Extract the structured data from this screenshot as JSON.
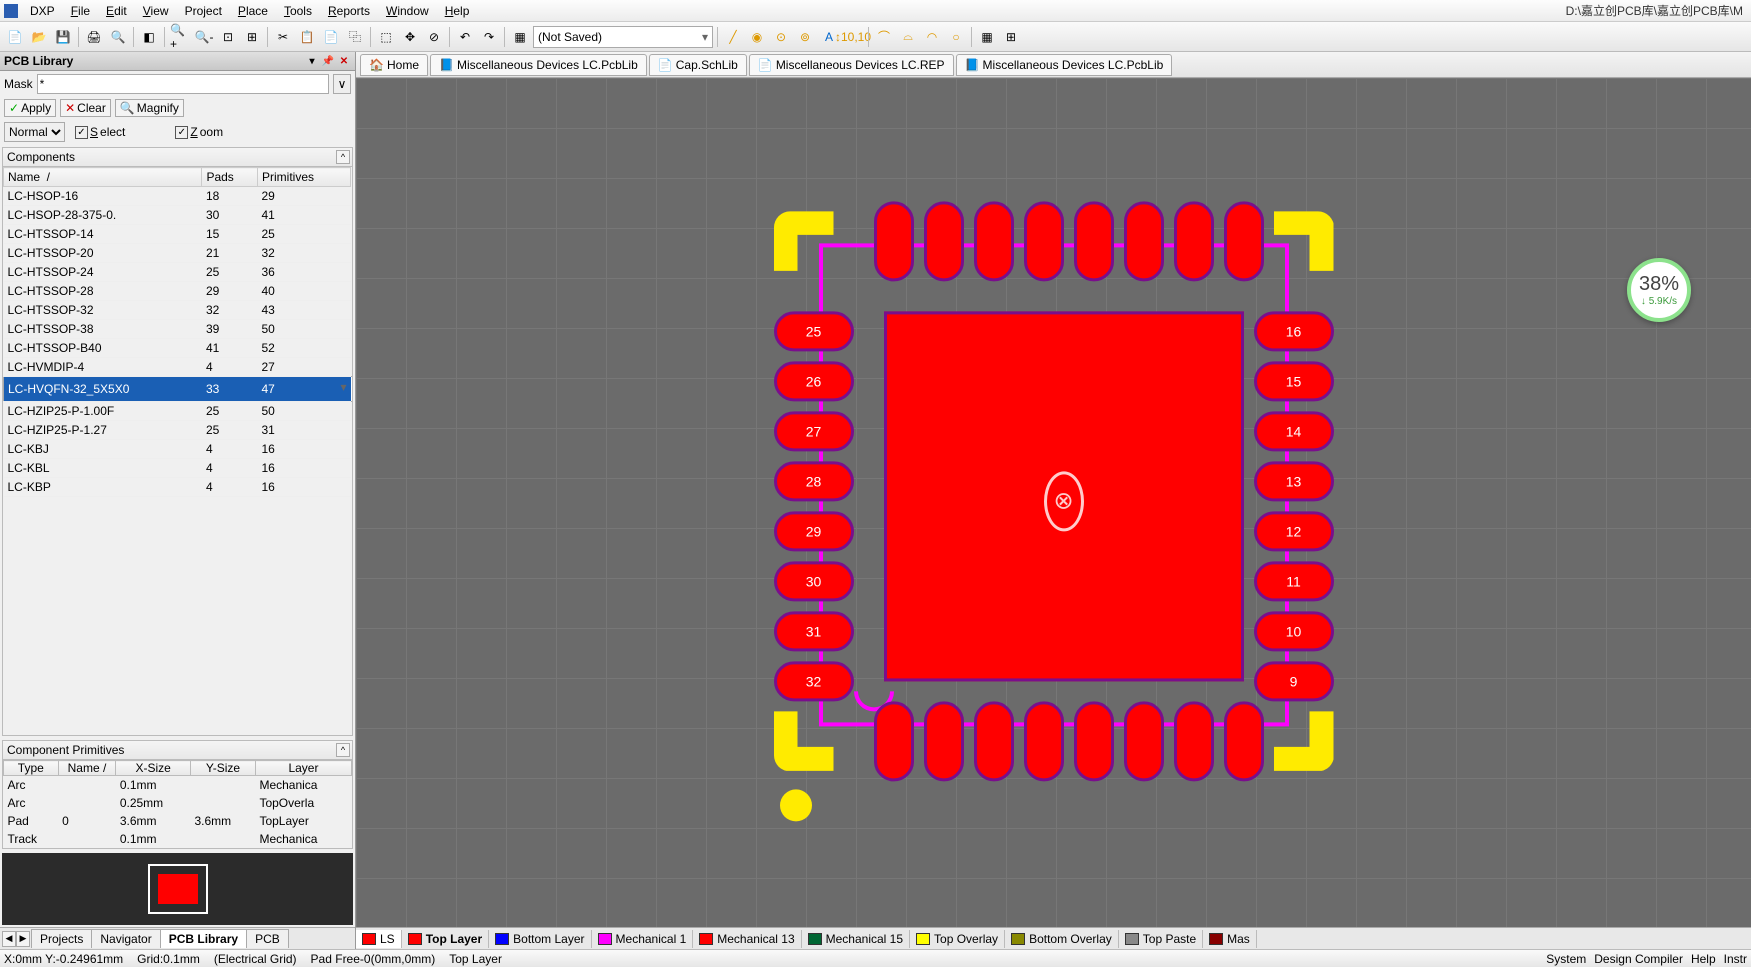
{
  "menu": {
    "dxp": "DXP",
    "file": "File",
    "edit": "Edit",
    "view": "View",
    "project": "Project",
    "place": "Place",
    "tools": "Tools",
    "reports": "Reports",
    "window": "Window",
    "help": "Help"
  },
  "titlepath": "D:\\嘉立创PCB库\\嘉立创PCB库\\M",
  "toolbar": {
    "notsaved": "(Not Saved)"
  },
  "panel": {
    "title": "PCB Library",
    "mask_label": "Mask",
    "mask_value": "*",
    "apply": "Apply",
    "clear": "Clear",
    "magnify": "Magnify",
    "normal": "Normal",
    "select": "Select",
    "zoom": "Zoom",
    "components": "Components",
    "cols": {
      "name": "Name",
      "pads": "Pads",
      "prims": "Primitives"
    },
    "rows": [
      {
        "n": "LC-HSOP-16",
        "p": "18",
        "r": "29"
      },
      {
        "n": "LC-HSOP-28-375-0.",
        "p": "30",
        "r": "41"
      },
      {
        "n": "LC-HTSSOP-14",
        "p": "15",
        "r": "25"
      },
      {
        "n": "LC-HTSSOP-20",
        "p": "21",
        "r": "32"
      },
      {
        "n": "LC-HTSSOP-24",
        "p": "25",
        "r": "36"
      },
      {
        "n": "LC-HTSSOP-28",
        "p": "29",
        "r": "40"
      },
      {
        "n": "LC-HTSSOP-32",
        "p": "32",
        "r": "43"
      },
      {
        "n": "LC-HTSSOP-38",
        "p": "39",
        "r": "50"
      },
      {
        "n": "LC-HTSSOP-B40",
        "p": "41",
        "r": "52"
      },
      {
        "n": "LC-HVMDIP-4",
        "p": "4",
        "r": "27"
      },
      {
        "n": "LC-HVQFN-32_5X5X0",
        "p": "33",
        "r": "47",
        "sel": true
      },
      {
        "n": "LC-HZIP25-P-1.00F",
        "p": "25",
        "r": "50"
      },
      {
        "n": "LC-HZIP25-P-1.27",
        "p": "25",
        "r": "31"
      },
      {
        "n": "LC-KBJ",
        "p": "4",
        "r": "16"
      },
      {
        "n": "LC-KBL",
        "p": "4",
        "r": "16"
      },
      {
        "n": "LC-KBP",
        "p": "4",
        "r": "16"
      }
    ],
    "primhdr": "Component Primitives",
    "primcols": {
      "type": "Type",
      "name": "Name",
      "xs": "X-Size",
      "ys": "Y-Size",
      "layer": "Layer"
    },
    "prims": [
      {
        "t": "Arc",
        "n": "",
        "x": "0.1mm",
        "y": "",
        "l": "Mechanica"
      },
      {
        "t": "Arc",
        "n": "",
        "x": "0.25mm",
        "y": "",
        "l": "TopOverla"
      },
      {
        "t": "Pad",
        "n": "0",
        "x": "3.6mm",
        "y": "3.6mm",
        "l": "TopLayer"
      },
      {
        "t": "Track",
        "n": "",
        "x": "0.1mm",
        "y": "",
        "l": "Mechanica"
      }
    ]
  },
  "bottomtabs": {
    "projects": "Projects",
    "navigator": "Navigator",
    "pcblib": "PCB Library",
    "pcb": "PCB"
  },
  "doctabs": {
    "home": "Home",
    "misc1": "Miscellaneous Devices LC.PcbLib",
    "cap": "Cap.SchLib",
    "miscrep": "Miscellaneous Devices LC.REP",
    "misc2": "Miscellaneous Devices LC.PcbLib"
  },
  "pads_left": [
    "25",
    "26",
    "27",
    "28",
    "29",
    "30",
    "31",
    "32"
  ],
  "pads_right": [
    "16",
    "15",
    "14",
    "13",
    "12",
    "11",
    "10",
    "9"
  ],
  "layertabs": [
    {
      "c": "#f00",
      "t": "LS",
      "a": true
    },
    {
      "c": "#f00",
      "t": "Top Layer",
      "bold": true
    },
    {
      "c": "#00f",
      "t": "Bottom Layer"
    },
    {
      "c": "#f0f",
      "t": "Mechanical 1"
    },
    {
      "c": "#f00",
      "t": "Mechanical 13"
    },
    {
      "c": "#063",
      "t": "Mechanical 15"
    },
    {
      "c": "#ff0",
      "t": "Top Overlay"
    },
    {
      "c": "#880",
      "t": "Bottom Overlay"
    },
    {
      "c": "#888",
      "t": "Top Paste"
    },
    {
      "c": "#800",
      "t": "Mas"
    }
  ],
  "status": {
    "xy": "X:0mm Y:-0.24961mm",
    "grid": "Grid:0.1mm",
    "eg": "(Electrical Grid)",
    "pad": "Pad Free-0(0mm,0mm)",
    "layer": "Top Layer",
    "r1": "System",
    "r2": "Design Compiler",
    "r3": "Help",
    "r4": "Instr"
  },
  "badge": {
    "pct": "38%",
    "rate": "↓ 5.9K/s"
  }
}
